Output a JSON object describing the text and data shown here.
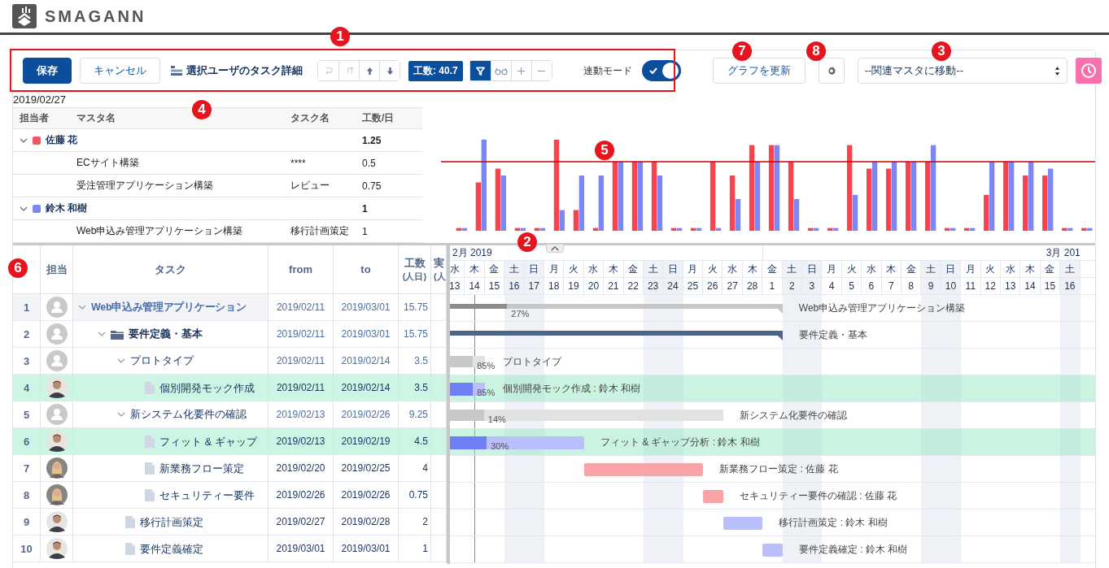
{
  "app": {
    "name": "SMAGANN"
  },
  "callouts": [
    {
      "label": "1"
    },
    {
      "label": "2"
    },
    {
      "label": "3"
    },
    {
      "label": "4"
    },
    {
      "label": "5"
    },
    {
      "label": "6"
    },
    {
      "label": "7"
    },
    {
      "label": "8"
    }
  ],
  "toolbar": {
    "save": "保存",
    "cancel": "キャンセル",
    "title": "選択ユーザのタスク詳細",
    "history_buttons": [
      {
        "kind": "undo",
        "disabled": true
      },
      {
        "kind": "redo",
        "disabled": true
      },
      {
        "kind": "up",
        "disabled": false
      },
      {
        "kind": "down",
        "disabled": false
      }
    ],
    "effort_badge": "工数: 40.7",
    "view_buttons": [
      {
        "kind": "filter",
        "selected": true
      },
      {
        "kind": "glasses",
        "selected": false
      },
      {
        "kind": "plus",
        "selected": false
      },
      {
        "kind": "minus",
        "selected": false
      }
    ],
    "link_mode": {
      "label": "連動モード",
      "on": true
    },
    "refresh": "グラフを更新",
    "master_select": {
      "value": "--関連マスタに移動--"
    }
  },
  "summary": {
    "date": "2019/02/27",
    "columns": [
      "担当者",
      "マスタ名",
      "タスク名",
      "工数/日"
    ],
    "groups": [
      {
        "name": "佐藤 花",
        "color": "#f25763",
        "total": "1.25",
        "expanded": true,
        "rows": [
          {
            "master": "ECサイト構築",
            "task": "****",
            "effort": "0.5"
          },
          {
            "master": "受注管理アプリケーション構築",
            "task": "レビュー",
            "effort": "0.75"
          }
        ]
      },
      {
        "name": "鈴木 和樹",
        "color": "#7b87f7",
        "total": "1",
        "expanded": true,
        "rows": [
          {
            "master": "Web申込み管理アプリケーション構築",
            "task": "移行計画策定",
            "effort": "1"
          }
        ]
      }
    ]
  },
  "gantt": {
    "columns": [
      {
        "lines": [
          "担当"
        ]
      },
      {
        "lines": [
          "タスク"
        ]
      },
      {
        "lines": [
          "from"
        ]
      },
      {
        "lines": [
          "to"
        ]
      },
      {
        "lines": [
          "工数",
          "(人日)"
        ]
      },
      {
        "lines": [
          "実",
          "(人"
        ]
      }
    ],
    "months": [
      {
        "label": "2月 2019",
        "days": [
          {
            "dow": "水",
            "day": "13",
            "weekend": false,
            "today": false
          },
          {
            "dow": "木",
            "day": "14",
            "weekend": false,
            "today": true
          },
          {
            "dow": "金",
            "day": "15",
            "weekend": false,
            "today": false
          },
          {
            "dow": "土",
            "day": "16",
            "weekend": true,
            "today": false
          },
          {
            "dow": "日",
            "day": "17",
            "weekend": true,
            "today": false
          },
          {
            "dow": "月",
            "day": "18",
            "weekend": false,
            "today": false
          },
          {
            "dow": "火",
            "day": "19",
            "weekend": false,
            "today": false
          },
          {
            "dow": "水",
            "day": "20",
            "weekend": false,
            "today": false
          },
          {
            "dow": "木",
            "day": "21",
            "weekend": false,
            "today": false
          },
          {
            "dow": "金",
            "day": "22",
            "weekend": false,
            "today": false
          },
          {
            "dow": "土",
            "day": "23",
            "weekend": true,
            "today": false
          },
          {
            "dow": "日",
            "day": "24",
            "weekend": true,
            "today": false
          },
          {
            "dow": "月",
            "day": "25",
            "weekend": false,
            "today": false
          },
          {
            "dow": "火",
            "day": "26",
            "weekend": false,
            "today": false
          },
          {
            "dow": "水",
            "day": "27",
            "weekend": false,
            "today": false
          },
          {
            "dow": "木",
            "day": "28",
            "weekend": false,
            "today": false
          }
        ]
      },
      {
        "label": "3月 201",
        "days": [
          {
            "dow": "金",
            "day": "1",
            "weekend": false,
            "today": false
          },
          {
            "dow": "土",
            "day": "2",
            "weekend": true,
            "today": false
          },
          {
            "dow": "日",
            "day": "3",
            "weekend": true,
            "today": false
          },
          {
            "dow": "月",
            "day": "4",
            "weekend": false,
            "today": false
          },
          {
            "dow": "火",
            "day": "5",
            "weekend": false,
            "today": false
          },
          {
            "dow": "水",
            "day": "6",
            "weekend": false,
            "today": false
          },
          {
            "dow": "木",
            "day": "7",
            "weekend": false,
            "today": false
          },
          {
            "dow": "金",
            "day": "8",
            "weekend": false,
            "today": false
          },
          {
            "dow": "土",
            "day": "9",
            "weekend": true,
            "today": false
          },
          {
            "dow": "日",
            "day": "10",
            "weekend": true,
            "today": false
          },
          {
            "dow": "月",
            "day": "11",
            "weekend": false,
            "today": false
          },
          {
            "dow": "火",
            "day": "12",
            "weekend": false,
            "today": false
          },
          {
            "dow": "水",
            "day": "13",
            "weekend": false,
            "today": false
          },
          {
            "dow": "木",
            "day": "14",
            "weekend": false,
            "today": false
          },
          {
            "dow": "金",
            "day": "15",
            "weekend": false,
            "today": false
          },
          {
            "dow": "土",
            "day": "16",
            "weekend": true,
            "today": false
          }
        ]
      }
    ],
    "tasks": [
      {
        "no": "1",
        "avatar": {
          "kind": "placeholder"
        },
        "kind": "project",
        "name": "Web申込み管理アプリケーション",
        "from": "2019/02/11",
        "to": "2019/03/01",
        "effort": "15.75",
        "selected": false,
        "hover": true,
        "expanded": true,
        "bar": {
          "kind": "project",
          "label": "Web申込み管理アプリケーション構築",
          "progress": "27%",
          "level": 0.27
        },
        "children": [
          {
            "no": "2",
            "avatar": {
              "kind": "placeholder"
            },
            "kind": "folder",
            "name": "要件定義・基本",
            "from": "2019/02/11",
            "to": "2019/03/01",
            "effort": "15.75",
            "selected": false,
            "hover": false,
            "expanded": true,
            "bar": {
              "kind": "group",
              "label": "要件定義・基本"
            },
            "children": [
              {
                "no": "3",
                "avatar": {
                  "kind": "placeholder"
                },
                "kind": "summary",
                "name": "プロトタイプ",
                "from": "2019/02/11",
                "to": "2019/02/14",
                "effort": "3.5",
                "selected": false,
                "hover": false,
                "expanded": true,
                "bar": {
                  "kind": "summary",
                  "label": "プロトタイプ",
                  "progress": "85%",
                  "level": 0.85
                },
                "children": [
                  {
                    "no": "4",
                    "avatar": {
                      "kind": "darkphoto"
                    },
                    "kind": "task",
                    "name": "個別開発モック作成",
                    "from": "2019/02/11",
                    "to": "2019/02/14",
                    "effort": "3.5",
                    "selected": true,
                    "hover": false,
                    "bar": {
                      "kind": "task",
                      "label": "個別開発モック作成 : 鈴木 和樹",
                      "progress": "85%",
                      "level": 0.85,
                      "color": "#b8bffa"
                    }
                  }
                ]
              },
              {
                "no": "5",
                "avatar": {
                  "kind": "placeholder"
                },
                "kind": "summary",
                "name": "新システム化要件の確認",
                "from": "2019/02/13",
                "to": "2019/02/26",
                "effort": "9.25",
                "selected": false,
                "hover": false,
                "expanded": true,
                "bar": {
                  "kind": "summary",
                  "label": "新システム化要件の確認",
                  "progress": "14%",
                  "level": 0.14
                },
                "children": [
                  {
                    "no": "6",
                    "avatar": {
                      "kind": "darkphoto"
                    },
                    "kind": "task",
                    "name": "フィット & ギャップ",
                    "from": "2019/02/13",
                    "to": "2019/02/19",
                    "effort": "4.5",
                    "selected": true,
                    "hover": false,
                    "bar": {
                      "kind": "task",
                      "label": "フィット & ギャップ分析 : 鈴木 和樹",
                      "progress": "30%",
                      "level": 0.3,
                      "color": "#b8bffa"
                    }
                  },
                  {
                    "no": "7",
                    "avatar": {
                      "kind": "lightphoto"
                    },
                    "kind": "task",
                    "name": "新業務フロー策定",
                    "from": "2019/02/20",
                    "to": "2019/02/25",
                    "effort": "4",
                    "selected": false,
                    "hover": false,
                    "bar": {
                      "kind": "task",
                      "label": "新業務フロー策定 : 佐藤 花",
                      "color": "#f9a3a8"
                    }
                  },
                  {
                    "no": "8",
                    "avatar": {
                      "kind": "lightphoto"
                    },
                    "kind": "task",
                    "name": "セキュリティー要件",
                    "from": "2019/02/26",
                    "to": "2019/02/26",
                    "effort": "0.75",
                    "selected": false,
                    "hover": false,
                    "bar": {
                      "kind": "task",
                      "label": "セキュリティー要件の確認 : 佐藤 花",
                      "color": "#f9a3a8"
                    }
                  }
                ]
              },
              {
                "no": "9",
                "avatar": {
                  "kind": "darkphoto"
                },
                "kind": "task",
                "name": "移行計画策定",
                "from": "2019/02/27",
                "to": "2019/02/28",
                "effort": "2",
                "selected": false,
                "hover": false,
                "bar": {
                  "kind": "task",
                  "label": "移行計画策定 : 鈴木 和樹",
                  "color": "#b8bffa"
                }
              },
              {
                "no": "10",
                "avatar": {
                  "kind": "darkphoto"
                },
                "kind": "task",
                "name": "要件定義確定",
                "from": "2019/03/01",
                "to": "2019/03/01",
                "effort": "1",
                "selected": false,
                "hover": false,
                "bar": {
                  "kind": "task",
                  "label": "要件定義確定 : 鈴木 和樹",
                  "color": "#b8bffa"
                }
              }
            ]
          }
        ]
      }
    ]
  }
}
